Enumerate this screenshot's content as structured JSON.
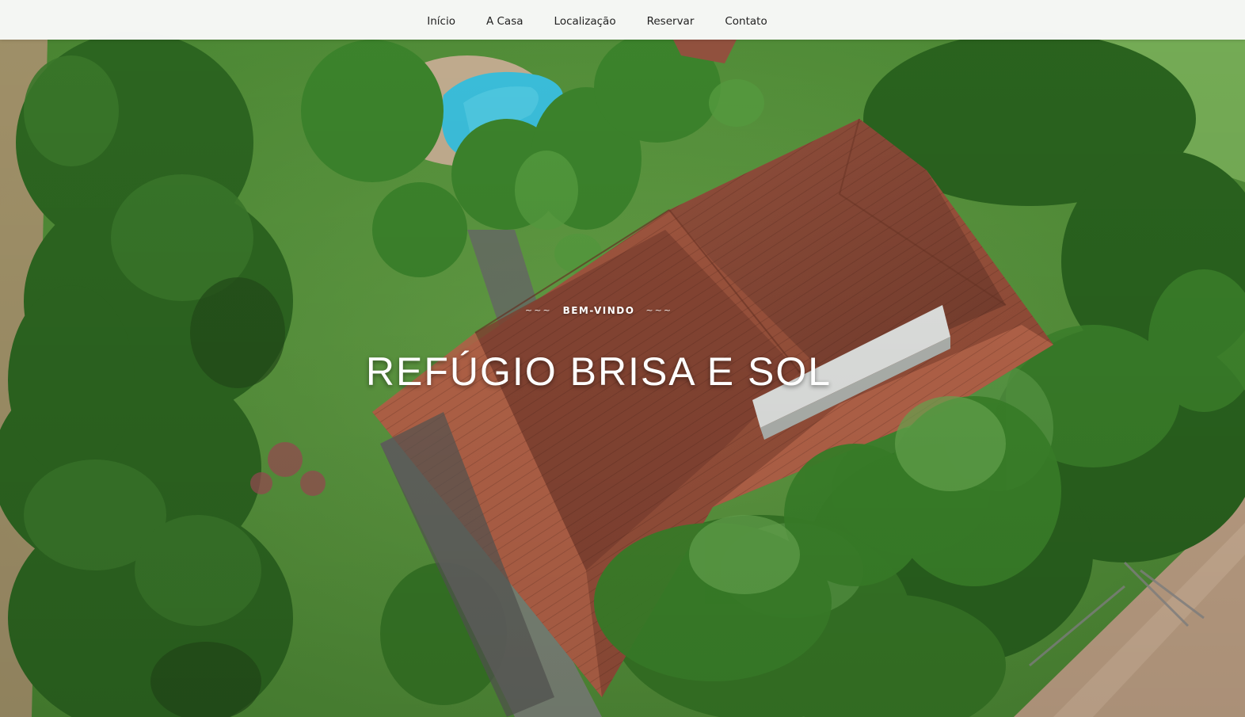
{
  "nav": {
    "items": [
      {
        "label": "Início"
      },
      {
        "label": "A Casa"
      },
      {
        "label": "Localização"
      },
      {
        "label": "Reservar"
      },
      {
        "label": "Contato"
      }
    ]
  },
  "hero": {
    "eyebrow_left": "~~~",
    "eyebrow": "BEM-VINDO",
    "eyebrow_right": "~~~",
    "title": "REFÚGIO BRISA E SOL",
    "image_subject": "aerial view of house with terracotta roof, pool and gardens"
  },
  "colors": {
    "navbar_bg": "#fafafa",
    "nav_text": "#222222",
    "hero_text": "#ffffff",
    "roof": "#a85a44",
    "grass": "#5a9a3e",
    "pool": "#3ec8e6"
  }
}
